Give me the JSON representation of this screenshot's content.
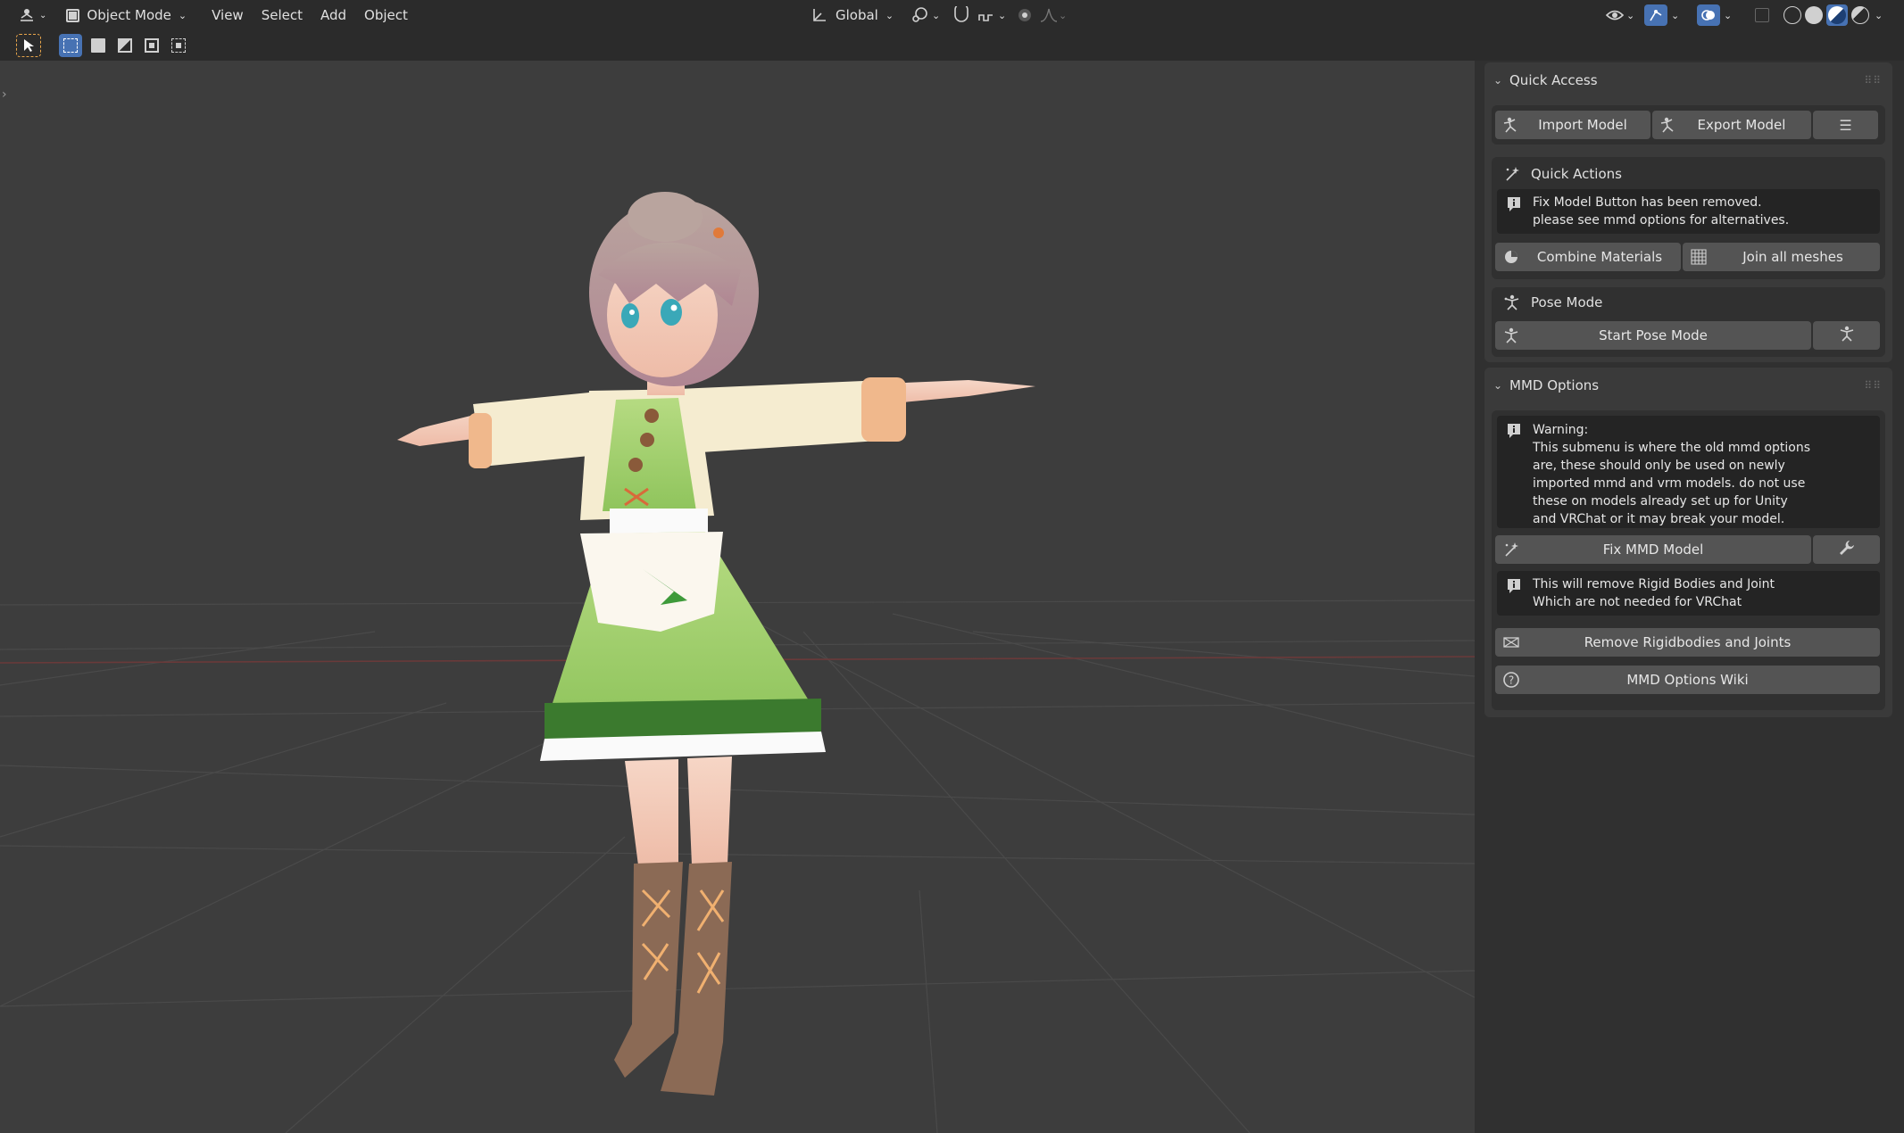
{
  "header": {
    "mode": "Object Mode",
    "menus": [
      "View",
      "Select",
      "Add",
      "Object"
    ],
    "orientation": "Global"
  },
  "quick_access": {
    "title": "Quick Access",
    "import_label": "Import Model",
    "export_label": "Export Model",
    "quick_actions": {
      "title": "Quick Actions",
      "info_line1": "Fix Model Button has been removed.",
      "info_line2": "please see mmd options for alternatives.",
      "combine_label": "Combine Materials",
      "join_label": "Join all meshes"
    },
    "pose_mode": {
      "title": "Pose Mode",
      "start_label": "Start Pose Mode"
    }
  },
  "mmd_options": {
    "title": "MMD Options",
    "warning_lines": [
      "Warning:",
      "This submenu is where the old mmd options",
      "are, these should only be used on newly",
      "imported mmd and vrm models. do not use",
      "these on models already set up for Unity",
      "and VRChat or it may break your model."
    ],
    "fix_label": "Fix MMD Model",
    "rigid_info_line1": "This will remove Rigid Bodies and Joint",
    "rigid_info_line2": "Which are not needed for VRChat",
    "remove_label": "Remove Rigidbodies and Joints",
    "wiki_label": "MMD Options Wiki"
  }
}
